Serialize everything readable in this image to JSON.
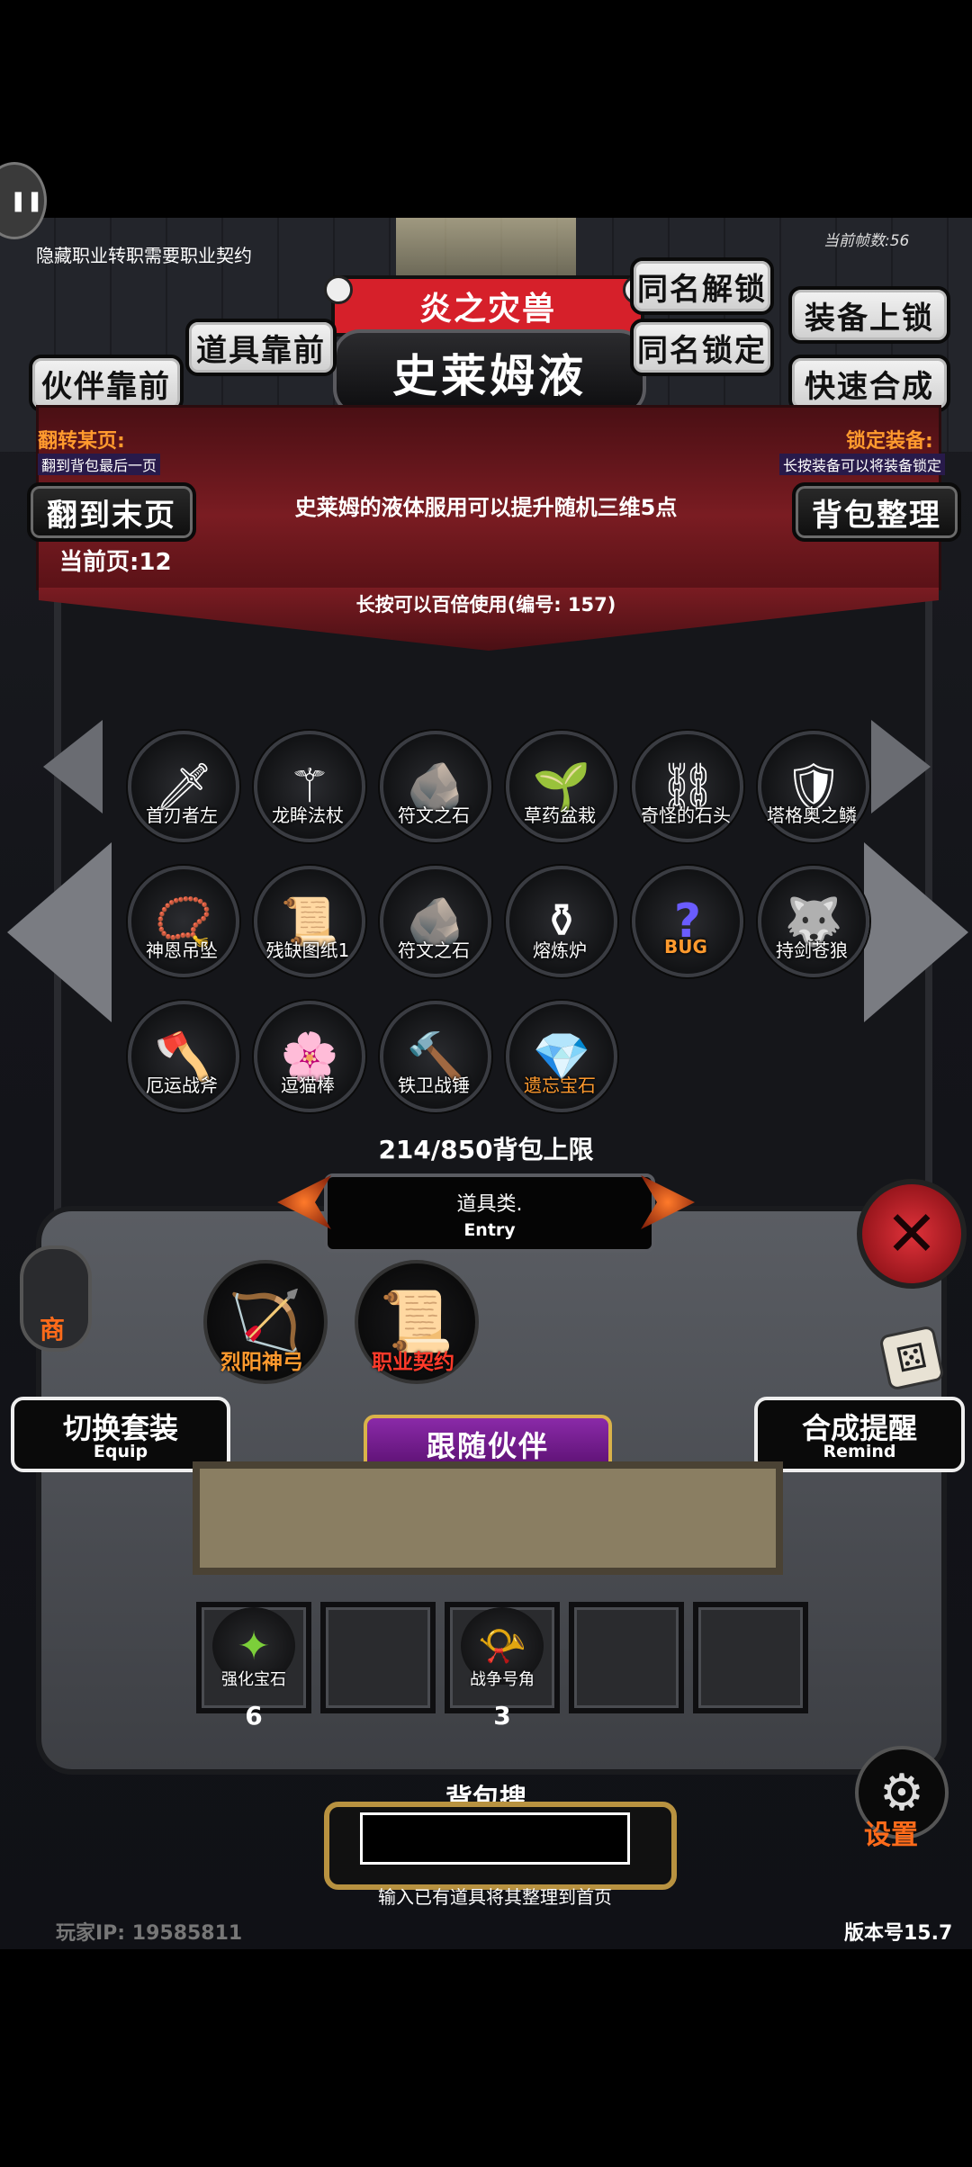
{
  "top_left_notice": "隐藏职业转职需要职业契约",
  "fps_label": "当前帧数:56",
  "boss": {
    "title": "炎之灾兽",
    "name": "史莱姆液"
  },
  "buttons": {
    "same_name_unlock": "同名解锁",
    "same_name_lock": "同名锁定",
    "equip_lock": "装备上锁",
    "quick_merge": "快速合成",
    "item_front": "道具靠前",
    "partner_front": "伙伴靠前",
    "flip_last": "翻到末页",
    "bag_sort": "背包整理",
    "switch_set": "切换套装",
    "switch_set_sub": "Equip",
    "merge_remind": "合成提醒",
    "merge_remind_sub": "Remind",
    "follow_partner": "跟随伙伴",
    "settings": "设置",
    "shop": "商"
  },
  "hints": {
    "flip_title": "翻转某页:",
    "flip_desc": "翻到背包最后一页",
    "lock_title": "锁定装备:",
    "lock_desc": "长按装备可以将装备锁定",
    "current_page": "当前页:12",
    "item_desc": "史莱姆的液体服用可以提升随机三维5点",
    "long_press": "长按可以百倍使用(编号: 157)"
  },
  "items": [
    {
      "label": "首刃者左",
      "icon": "knife-icon",
      "glyph": "🗡"
    },
    {
      "label": "龙眸法杖",
      "icon": "staff-icon",
      "glyph": "⚚"
    },
    {
      "label": "符文之石",
      "icon": "rune-stone-icon",
      "glyph": "🪨"
    },
    {
      "label": "草药盆栽",
      "icon": "herb-pot-icon",
      "glyph": "🌱"
    },
    {
      "label": "奇怪的石头",
      "icon": "strange-stone-icon",
      "glyph": "⛓"
    },
    {
      "label": "塔格奥之鳞",
      "icon": "scale-icon",
      "glyph": "🛡"
    },
    {
      "label": "神恩吊坠",
      "icon": "pendant-icon",
      "glyph": "📿"
    },
    {
      "label": "残缺图纸1",
      "icon": "blueprint-icon",
      "glyph": "📜"
    },
    {
      "label": "符文之石",
      "icon": "rune-stone-icon",
      "glyph": "🪨"
    },
    {
      "label": "熔炼炉",
      "icon": "furnace-icon",
      "glyph": "⚱"
    },
    {
      "label": "",
      "icon": "bug-icon",
      "glyph": "?",
      "caption": "BUG"
    },
    {
      "label": "持剑苍狼",
      "icon": "wolf-icon",
      "glyph": "🐺"
    },
    {
      "label": "厄运战斧",
      "icon": "axe-icon",
      "glyph": "🪓"
    },
    {
      "label": "逗猫棒",
      "icon": "cat-wand-icon",
      "glyph": "🌸"
    },
    {
      "label": "铁卫战锤",
      "icon": "hammer-icon",
      "glyph": "🔨"
    },
    {
      "label": "遗忘宝石",
      "icon": "crystal-icon",
      "glyph": "💎",
      "highlight": "#ff9a2e"
    }
  ],
  "bag_capacity": "214/850背包上限",
  "category": {
    "label": "道具类.",
    "sub": "Entry"
  },
  "equipped": [
    {
      "label": "烈阳神弓",
      "icon": "bow-icon",
      "glyph": "🏹"
    },
    {
      "label": "职业契约",
      "icon": "contract-icon",
      "glyph": "📜"
    }
  ],
  "quick_slots": [
    {
      "label": "强化宝石",
      "count": "6",
      "icon": "green-gem-icon",
      "glyph": "✦"
    },
    {
      "label": "",
      "count": "",
      "icon": "",
      "glyph": ""
    },
    {
      "label": "战争号角",
      "count": "3",
      "icon": "war-horn-icon",
      "glyph": "📯"
    },
    {
      "label": "",
      "count": "",
      "icon": "",
      "glyph": ""
    },
    {
      "label": "",
      "count": "",
      "icon": "",
      "glyph": ""
    }
  ],
  "search": {
    "title": "背包搜索",
    "hint": "输入已有道具将其整理到首页",
    "value": ""
  },
  "footer": {
    "player_ip": "玩家IP:  19585811",
    "version": "版本号15.7"
  }
}
